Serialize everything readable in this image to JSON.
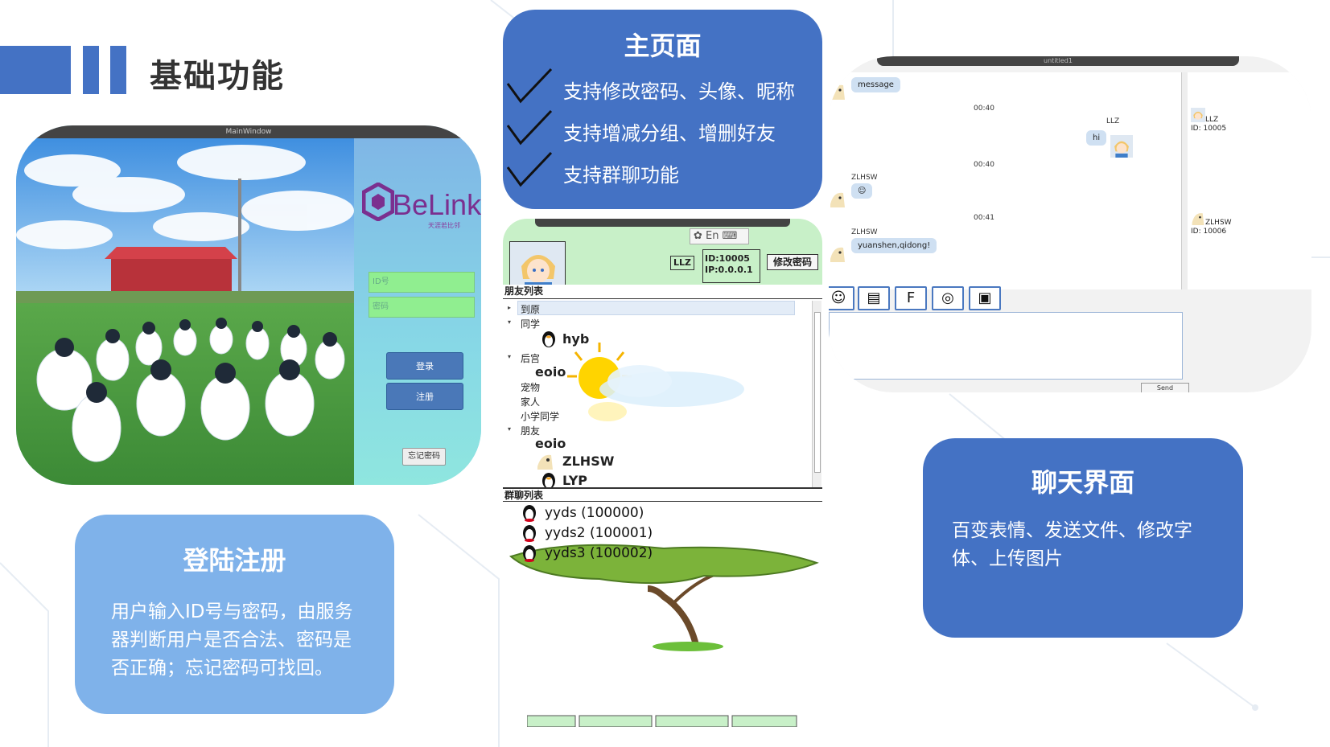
{
  "slide": {
    "title": "基础功能"
  },
  "login": {
    "window_title": "MainWindow",
    "logo_text": "BeLink",
    "logo_sub": "天涯若比邻",
    "id_placeholder": "ID号",
    "pwd_placeholder": "密码",
    "login_label": "登录",
    "register_label": "注册",
    "forgot_label": "忘记密码",
    "caption_title": "登陆注册",
    "caption_text": "用户输入ID号与密码，由服务器判断用户是否合法、密码是否正确；忘记密码可找回。"
  },
  "main": {
    "caption_title": "主页面",
    "features": [
      "支持修改密码、头像、昵称",
      "支持增减分组、增删好友",
      "支持群聊功能"
    ],
    "ime_label": "En",
    "nickname": "LLZ",
    "id_line": "ID:10005",
    "ip_line": "IP:0.0.0.1",
    "change_pwd_label": "修改密码",
    "friend_list_header": "朋友列表",
    "tree": [
      {
        "label": "到原",
        "arrow": "▸"
      },
      {
        "label": "同学",
        "arrow": "▾"
      },
      {
        "label": "hyb"
      },
      {
        "label": "后宫",
        "arrow": "▾"
      },
      {
        "label": "eoio"
      },
      {
        "label": "宠物"
      },
      {
        "label": "家人"
      },
      {
        "label": "小学同学"
      },
      {
        "label": "朋友",
        "arrow": "▾"
      },
      {
        "label": "eoio"
      },
      {
        "label": "ZLHSW"
      },
      {
        "label": "LYP"
      }
    ],
    "group_list_header": "群聊列表",
    "groups": [
      "yyds  (100000)",
      "yyds2  (100001)",
      "yyds3  (100002)"
    ]
  },
  "chat": {
    "window_title": "untitled1",
    "messages": {
      "m1": "message",
      "t1": "00:40",
      "s2": "LLZ",
      "m2": "hi",
      "t2": "00:40",
      "s3": "ZLHSW",
      "m3": "☺",
      "t3": "00:41",
      "s4": "ZLHSW",
      "m4": "yuanshen,qidong!"
    },
    "members": [
      {
        "name": "LLZ",
        "id": "ID: 10005"
      },
      {
        "name": "ZLHSW",
        "id": "ID: 10006"
      }
    ],
    "tools": [
      "☺",
      "▤",
      "F",
      "◎",
      "▣"
    ],
    "send_label": "Send",
    "caption_title": "聊天界面",
    "caption_text": "百变表情、发送文件、修改字体、上传图片"
  },
  "colors": {
    "accent": "#4472c4",
    "login_card": "#7fb2ea"
  }
}
